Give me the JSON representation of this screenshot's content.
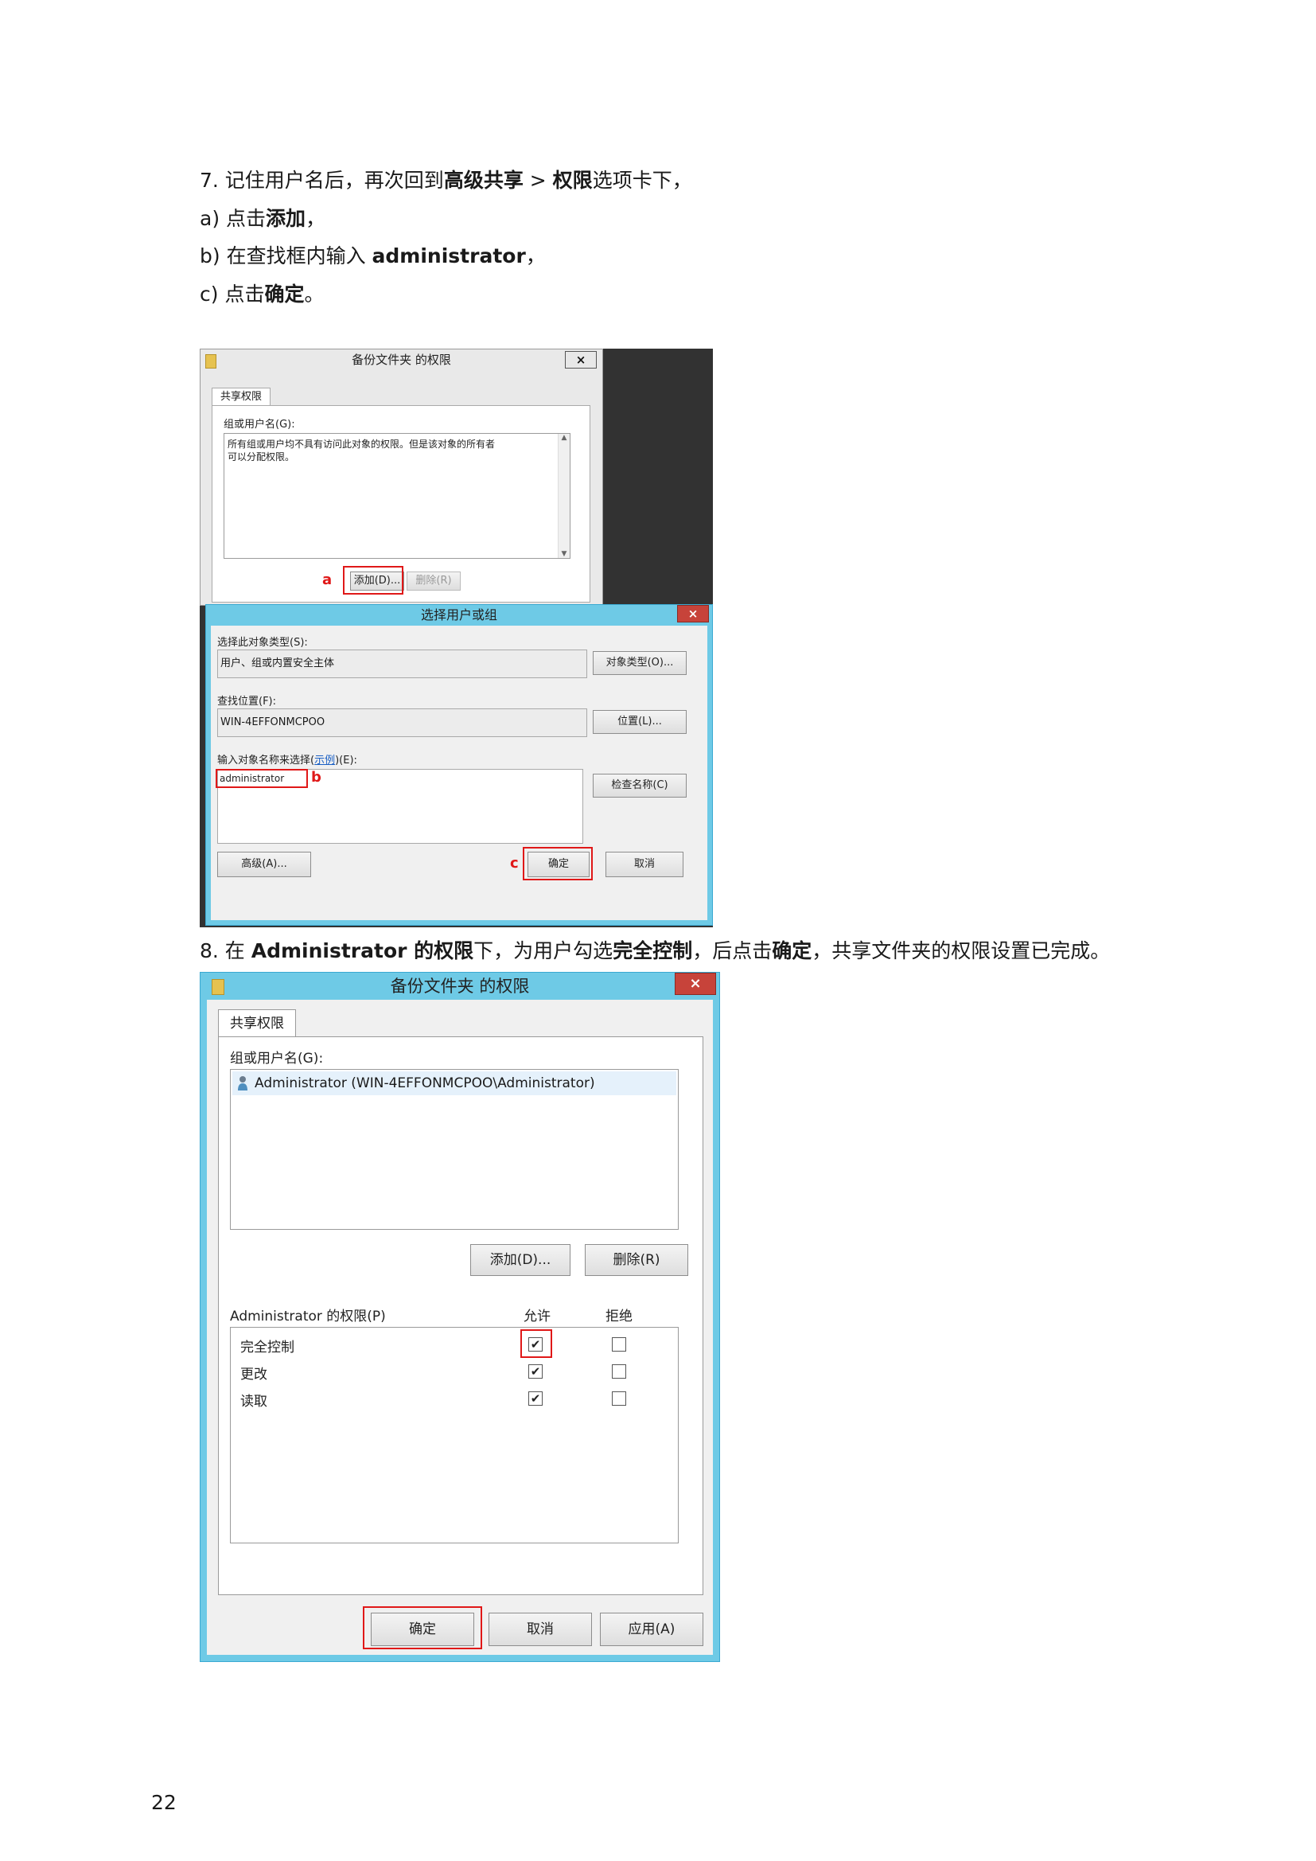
{
  "instructions": {
    "step7": {
      "prefix": "7. 记住用户名后，再次回到",
      "bold1": "高级共享",
      "mid": " > ",
      "bold2": "权限",
      "suffix": "选项卡下，"
    },
    "step7a": {
      "prefix": "a) 点击",
      "bold": "添加",
      "suffix": "，"
    },
    "step7b": {
      "prefix": "b) 在查找框内输入 ",
      "bold": "administrator",
      "suffix": "，"
    },
    "step7c": {
      "prefix": "c) 点击",
      "bold": "确定",
      "suffix": "。"
    },
    "step8": {
      "prefix": "8. 在 ",
      "bold1": "Administrator 的权限",
      "mid1": "下，为用户勾选",
      "bold2": "完全控制",
      "mid2": "，后点击",
      "bold3": "确定",
      "suffix": "，共享文件夹的权限设置已完成。"
    }
  },
  "screenshot1": {
    "perm_dialog": {
      "title": "备份文件夹 的权限",
      "close_glyph": "×",
      "tab": "共享权限",
      "group_label": "组或用户名(G):",
      "list_text_line1": "所有组或用户均不具有访问此对象的权限。但是该对象的所有者",
      "list_text_line2": "可以分配权限。",
      "add_button": "添加(D)...",
      "remove_button": "删除(R)",
      "marker_a": "a"
    },
    "select_dialog": {
      "title": "选择用户或组",
      "close_glyph": "×",
      "object_type_label": "选择此对象类型(S):",
      "object_type_value": "用户、组或内置安全主体",
      "object_types_button": "对象类型(O)...",
      "location_label": "查找位置(F):",
      "location_value": "WIN-4EFFONMCPOO",
      "location_button": "位置(L)...",
      "enter_label_prefix": "输入对象名称来选择(",
      "enter_label_link": "示例",
      "enter_label_suffix": ")(E):",
      "entered_name": "administrator",
      "check_names_button": "检查名称(C)",
      "advanced_button": "高级(A)...",
      "ok_button": "确定",
      "cancel_button": "取消",
      "marker_b": "b",
      "marker_c": "c"
    }
  },
  "screenshot2": {
    "title": "备份文件夹 的权限",
    "close_glyph": "×",
    "tab": "共享权限",
    "group_label": "组或用户名(G):",
    "user_entry": "Administrator (WIN-4EFFONMCPOO\\Administrator)",
    "add_button": "添加(D)...",
    "remove_button": "删除(R)",
    "perm_label": "Administrator 的权限(P)",
    "allow_header": "允许",
    "deny_header": "拒绝",
    "permissions": [
      {
        "name": "完全控制",
        "allow": "✔",
        "deny": ""
      },
      {
        "name": "更改",
        "allow": "✔",
        "deny": ""
      },
      {
        "name": "读取",
        "allow": "✔",
        "deny": ""
      }
    ],
    "ok_button": "确定",
    "cancel_button": "取消",
    "apply_button": "应用(A)"
  },
  "page_number": "22",
  "colors": {
    "highlight_red": "#e01818",
    "window_blue": "#6ecae6"
  }
}
